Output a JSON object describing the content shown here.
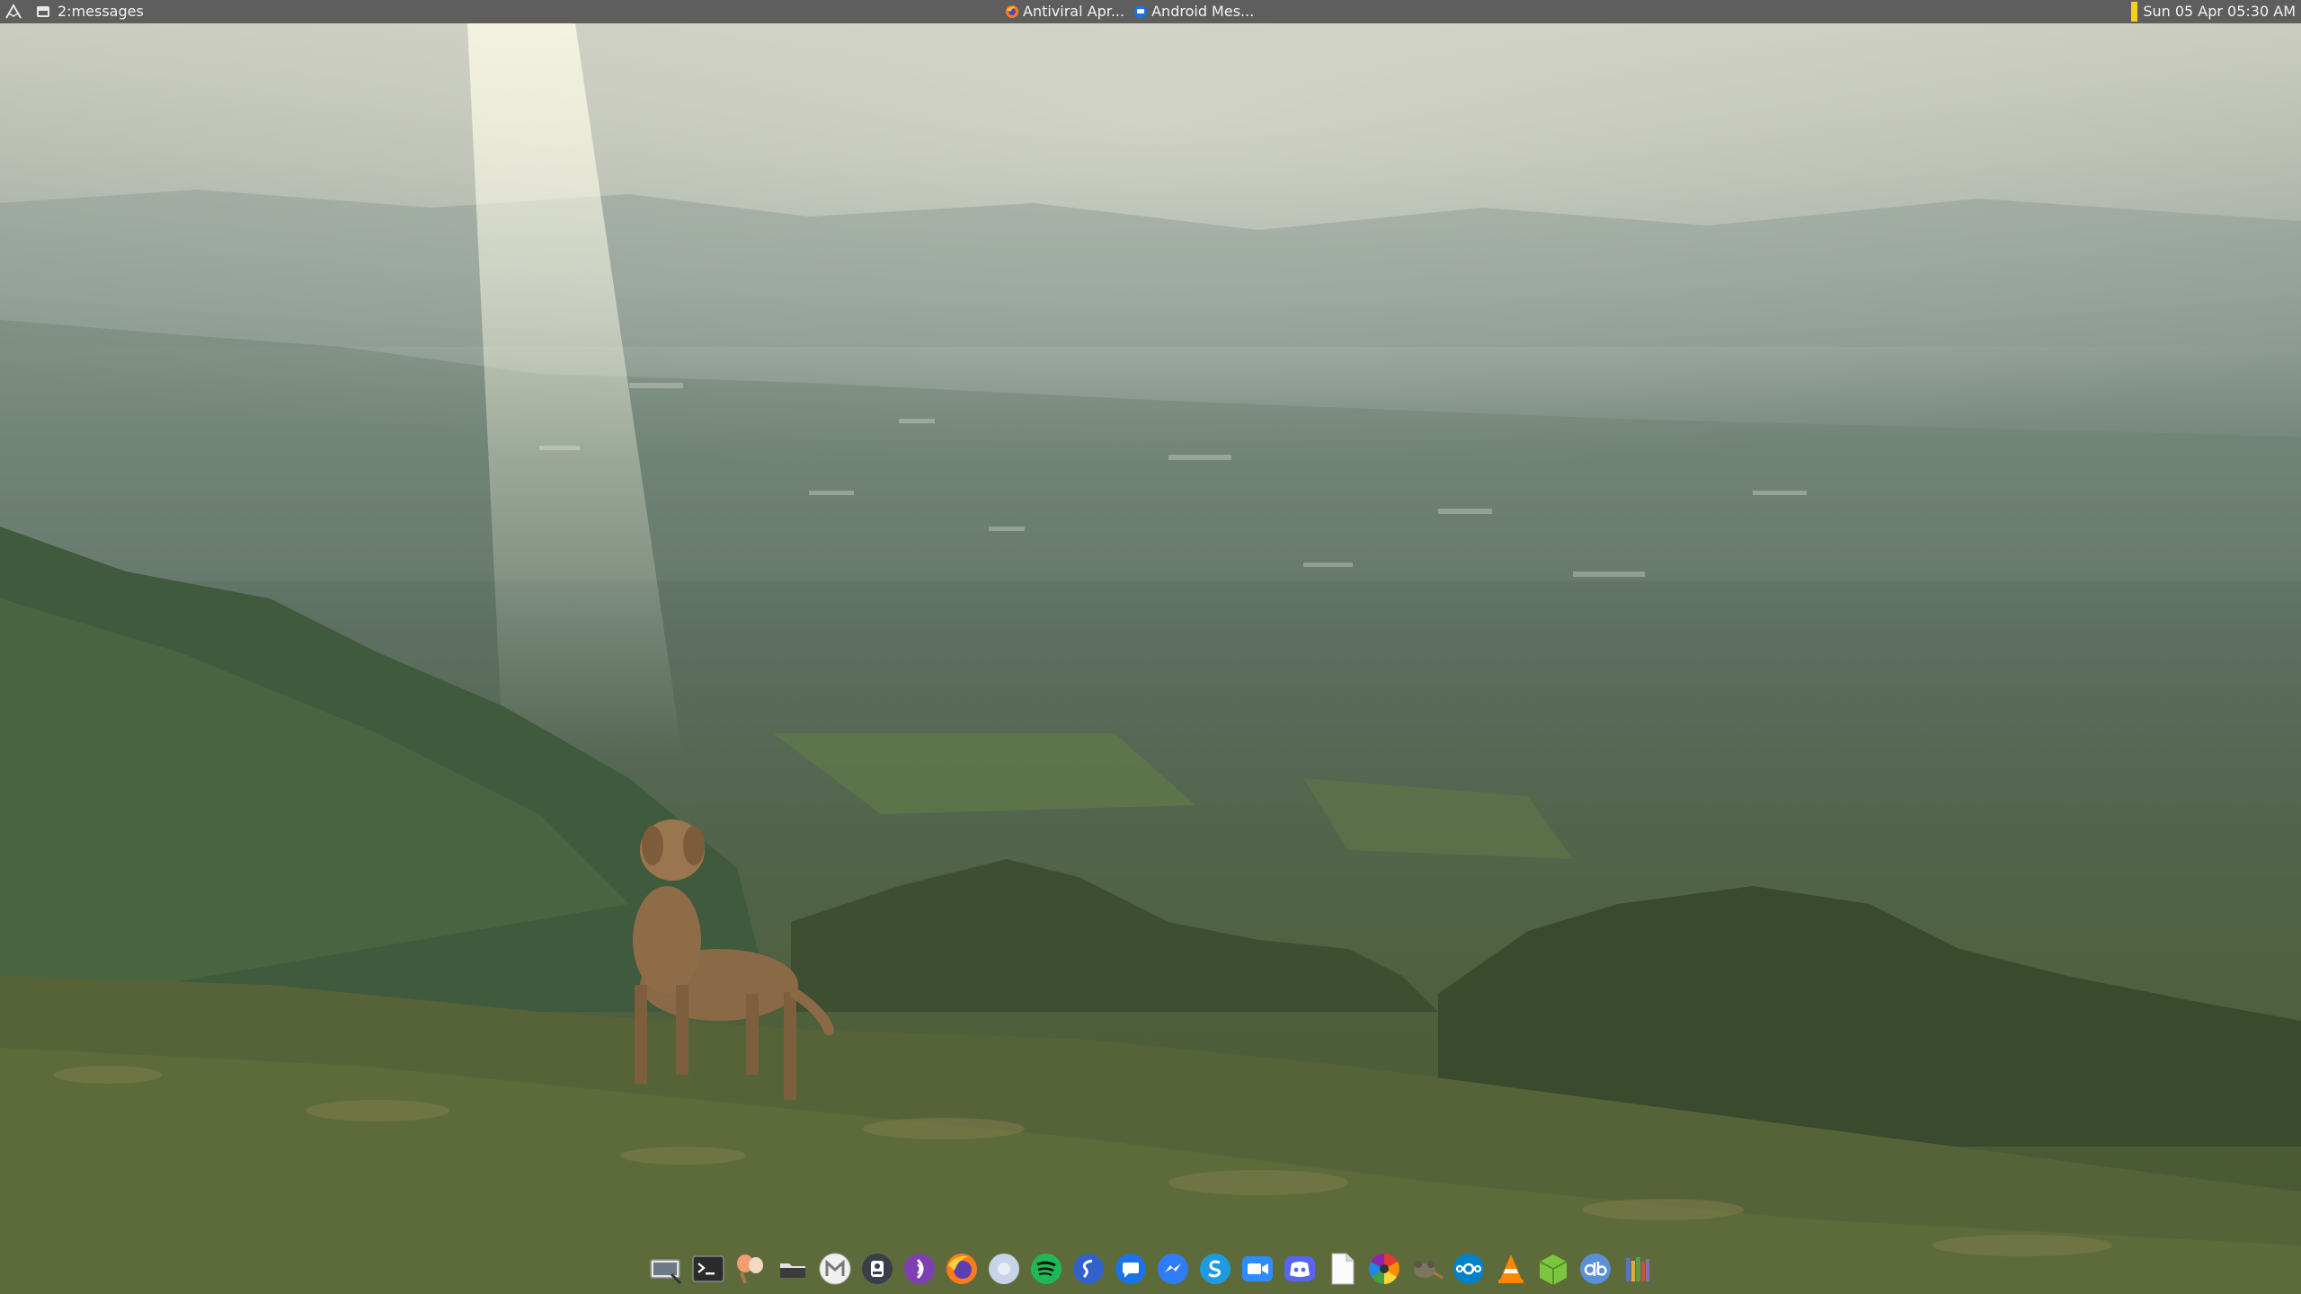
{
  "topbar": {
    "workspace_label": "2:messages",
    "tasks": [
      {
        "label": "Antiviral Apr...",
        "icon": "firefox-icon"
      },
      {
        "label": "Android Mes...",
        "icon": "messages-icon"
      }
    ],
    "clock": "Sun 05 Apr 05:30 AM",
    "tray_color": "#f3d21a"
  },
  "colors": {
    "bar_bg": "#5e5e5e",
    "bar_text": "#f2f2f2"
  },
  "dock": {
    "apps": [
      "screenshot-icon",
      "terminal-icon",
      "paint-icon",
      "files-icon",
      "gmail-icon",
      "signal-icon",
      "tor-icon",
      "firefox-icon",
      "chromium-icon",
      "spotify-icon",
      "simplenote-icon",
      "messages-icon",
      "messenger-icon",
      "skype-icon",
      "zoom-icon",
      "discord-icon",
      "document-icon",
      "color-wheel-icon",
      "gimp-icon",
      "nextcloud-icon",
      "vlc-icon",
      "package-icon",
      "qbittorrent-icon",
      "library-icon"
    ]
  }
}
